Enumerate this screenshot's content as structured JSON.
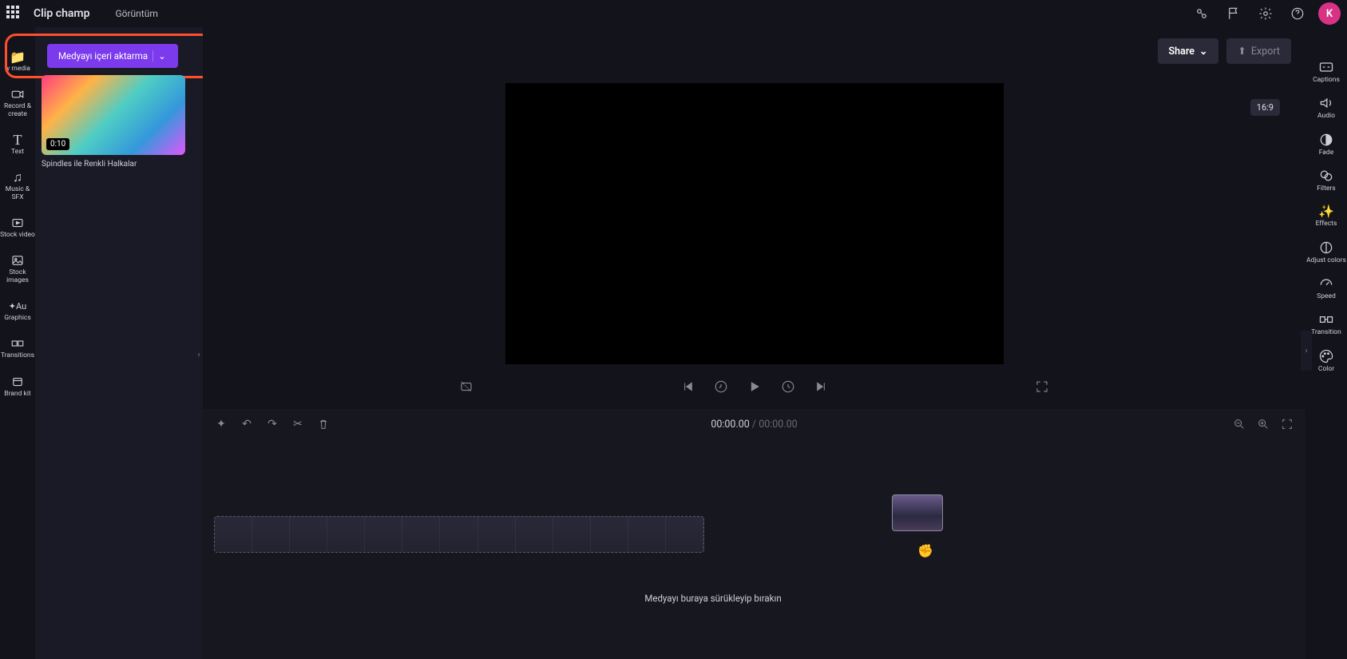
{
  "header": {
    "app_name": "Clip champ",
    "project_name": "Görüntüm",
    "avatar_initial": "K"
  },
  "left_nav": {
    "items": [
      {
        "label": "ly media"
      },
      {
        "label": "Record & create"
      },
      {
        "label": "Text"
      },
      {
        "label": "Music & SFX"
      },
      {
        "label": "Stock video"
      },
      {
        "label": "Stock images"
      },
      {
        "label": "Graphics"
      },
      {
        "label": "Transitions"
      },
      {
        "label": "Brand kit"
      }
    ]
  },
  "import_button": {
    "label": "Medyayı içeri aktarma"
  },
  "media": {
    "items": [
      {
        "duration": "0:10",
        "title": "Spindles ile Renkli Halkalar"
      }
    ]
  },
  "top_actions": {
    "share": "Share",
    "export": "Export",
    "aspect": "16:9"
  },
  "timecode": {
    "current": "00:00.00",
    "total": "00:00.00"
  },
  "timeline": {
    "drop_hint": "Medyayı buraya sürükleyip bırakın"
  },
  "right_nav": {
    "items": [
      {
        "label": "Captions"
      },
      {
        "label": "Audio"
      },
      {
        "label": "Fade"
      },
      {
        "label": "Filters"
      },
      {
        "label": "Effects"
      },
      {
        "label": "Adjust colors"
      },
      {
        "label": "Speed"
      },
      {
        "label": "Transition"
      },
      {
        "label": "Color"
      }
    ]
  }
}
